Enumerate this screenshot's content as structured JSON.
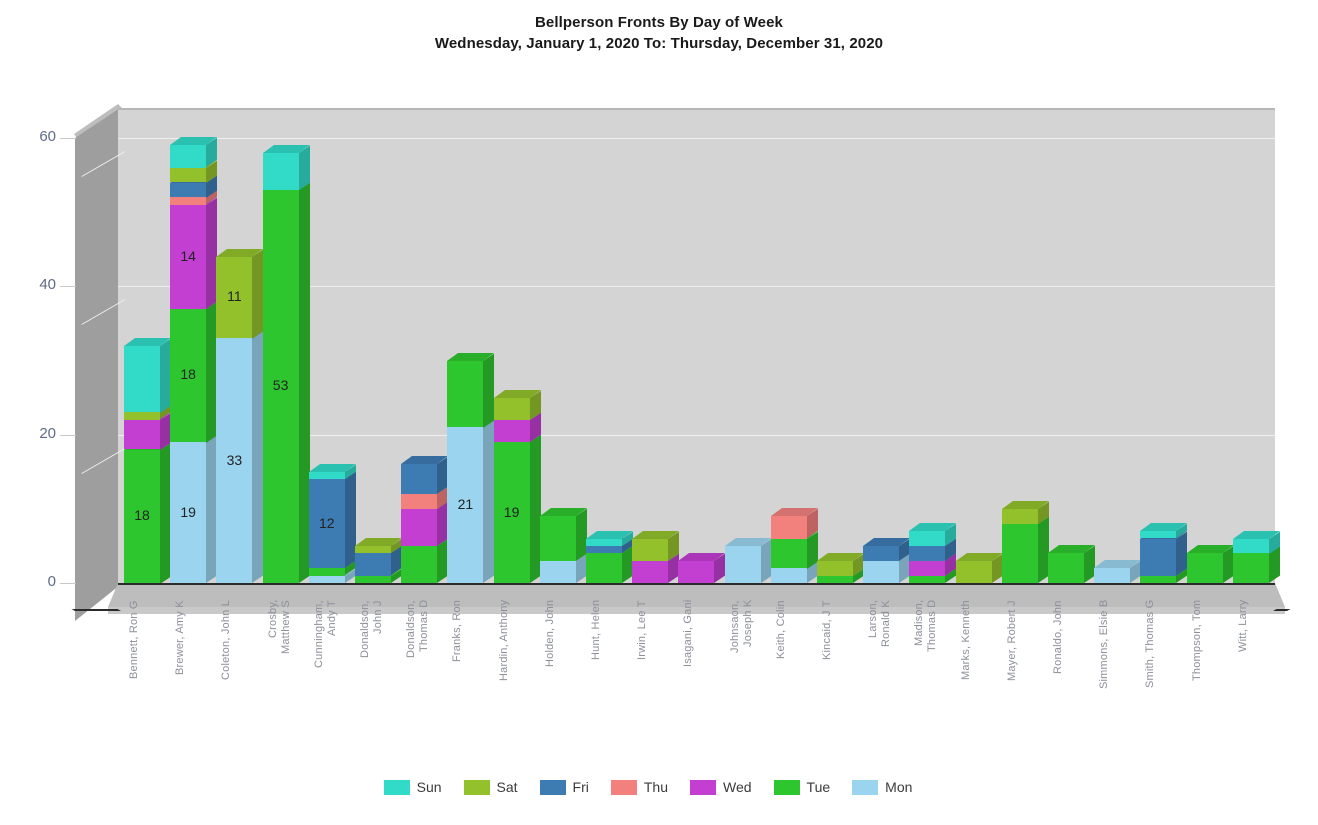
{
  "title": {
    "line1": "Bellperson Fronts By Day of Week",
    "line2": "Wednesday, January 1, 2020 To: Thursday, December 31, 2020"
  },
  "legend": {
    "position": "bottom-center",
    "items": [
      {
        "label": "Sun",
        "color": "#31dbc8"
      },
      {
        "label": "Sat",
        "color": "#93c12c"
      },
      {
        "label": "Fri",
        "color": "#3d7cb3"
      },
      {
        "label": "Thu",
        "color": "#f2807d"
      },
      {
        "label": "Wed",
        "color": "#c23fd1"
      },
      {
        "label": "Tue",
        "color": "#2ec62e"
      },
      {
        "label": "Mon",
        "color": "#9bd4ef"
      }
    ]
  },
  "yaxis": {
    "ticks": [
      "0",
      "20",
      "40",
      "60"
    ],
    "min": 0,
    "max": 60
  },
  "chart_data": {
    "type": "bar",
    "subtype": "stacked-3d",
    "title": "Bellperson Fronts By Day of Week",
    "subtitle": "Wednesday, January 1, 2020 To: Thursday, December 31, 2020",
    "xlabel": "",
    "ylabel": "",
    "ylim": [
      0,
      60
    ],
    "yticks": [
      0,
      20,
      40,
      60
    ],
    "grid": true,
    "legend_position": "bottom",
    "stack_order_bottom_to_top": [
      "Mon",
      "Tue",
      "Wed",
      "Thu",
      "Fri",
      "Sat",
      "Sun"
    ],
    "colors": {
      "Sun": "#31dbc8",
      "Sat": "#93c12c",
      "Fri": "#3d7cb3",
      "Thu": "#f2807d",
      "Wed": "#c23fd1",
      "Tue": "#2ec62e",
      "Mon": "#9bd4ef"
    },
    "categories": [
      "Bennett, Ron G",
      "Brewer, Amy K",
      "Coleton, John L",
      "Crosby,\nMatthew S",
      "Cunningham,\nAndy T",
      "Donaldson,\nJohn J",
      "Donaldson,\nThomas D",
      "Franks, Ron",
      "Hardin, Anthony",
      "Holden, John",
      "Hunt, Helen",
      "Irwin, Lee T",
      "Isagani, Gani",
      "Johnsaon,\nJoseph K",
      "Keith, Colin",
      "Kincaid, J T",
      "Larson,\nRonald K",
      "Madison,\nThomas D",
      "Marks, Kenneth",
      "Mayer, Robert J",
      "Ronaldo, John",
      "Simmons, Elsie B",
      "Smith, Thomas G",
      "Thompson, Tom",
      "Witt, Larry"
    ],
    "series": [
      {
        "name": "Mon",
        "values": [
          0,
          19,
          33,
          0,
          1,
          0,
          0,
          21,
          0,
          3,
          0,
          0,
          0,
          5,
          2,
          0,
          3,
          0,
          0,
          0,
          0,
          2,
          0,
          0,
          0
        ]
      },
      {
        "name": "Tue",
        "values": [
          18,
          18,
          0,
          53,
          1,
          1,
          5,
          9,
          19,
          6,
          4,
          0,
          0,
          0,
          4,
          1,
          0,
          1,
          0,
          8,
          4,
          0,
          1,
          4,
          4
        ]
      },
      {
        "name": "Wed",
        "values": [
          4,
          14,
          0,
          0,
          0,
          0,
          5,
          0,
          3,
          0,
          0,
          3,
          3,
          0,
          0,
          0,
          0,
          2,
          0,
          0,
          0,
          0,
          0,
          0,
          0
        ]
      },
      {
        "name": "Thu",
        "values": [
          0,
          1,
          0,
          0,
          0,
          0,
          2,
          0,
          0,
          0,
          0,
          0,
          0,
          0,
          3,
          0,
          0,
          0,
          0,
          0,
          0,
          0,
          0,
          0,
          0
        ]
      },
      {
        "name": "Fri",
        "values": [
          0,
          2,
          0,
          0,
          12,
          3,
          4,
          0,
          0,
          0,
          1,
          0,
          0,
          0,
          0,
          0,
          2,
          2,
          0,
          0,
          0,
          0,
          5,
          0,
          0
        ]
      },
      {
        "name": "Sat",
        "values": [
          1,
          2,
          11,
          0,
          0,
          1,
          0,
          0,
          3,
          0,
          0,
          3,
          0,
          0,
          0,
          2,
          0,
          0,
          3,
          2,
          0,
          0,
          0,
          0,
          0
        ]
      },
      {
        "name": "Sun",
        "values": [
          9,
          3,
          0,
          5,
          1,
          0,
          0,
          0,
          0,
          0,
          1,
          0,
          0,
          0,
          0,
          0,
          0,
          2,
          0,
          0,
          0,
          0,
          1,
          0,
          2
        ]
      }
    ],
    "value_labels": [
      {
        "category": "Bennett, Ron G",
        "series": "Tue",
        "value": 18
      },
      {
        "category": "Brewer, Amy K",
        "series": "Mon",
        "value": 19
      },
      {
        "category": "Brewer, Amy K",
        "series": "Tue",
        "value": 18
      },
      {
        "category": "Brewer, Amy K",
        "series": "Wed",
        "value": 14
      },
      {
        "category": "Coleton, John L",
        "series": "Mon",
        "value": 33
      },
      {
        "category": "Coleton, John L",
        "series": "Sat",
        "value": 11
      },
      {
        "category": "Crosby, Matthew S",
        "series": "Tue",
        "value": 53
      },
      {
        "category": "Cunningham, Andy T",
        "series": "Fri",
        "value": 12
      },
      {
        "category": "Franks, Ron",
        "series": "Mon",
        "value": 21
      },
      {
        "category": "Hardin, Anthony",
        "series": "Tue",
        "value": 19
      }
    ]
  }
}
